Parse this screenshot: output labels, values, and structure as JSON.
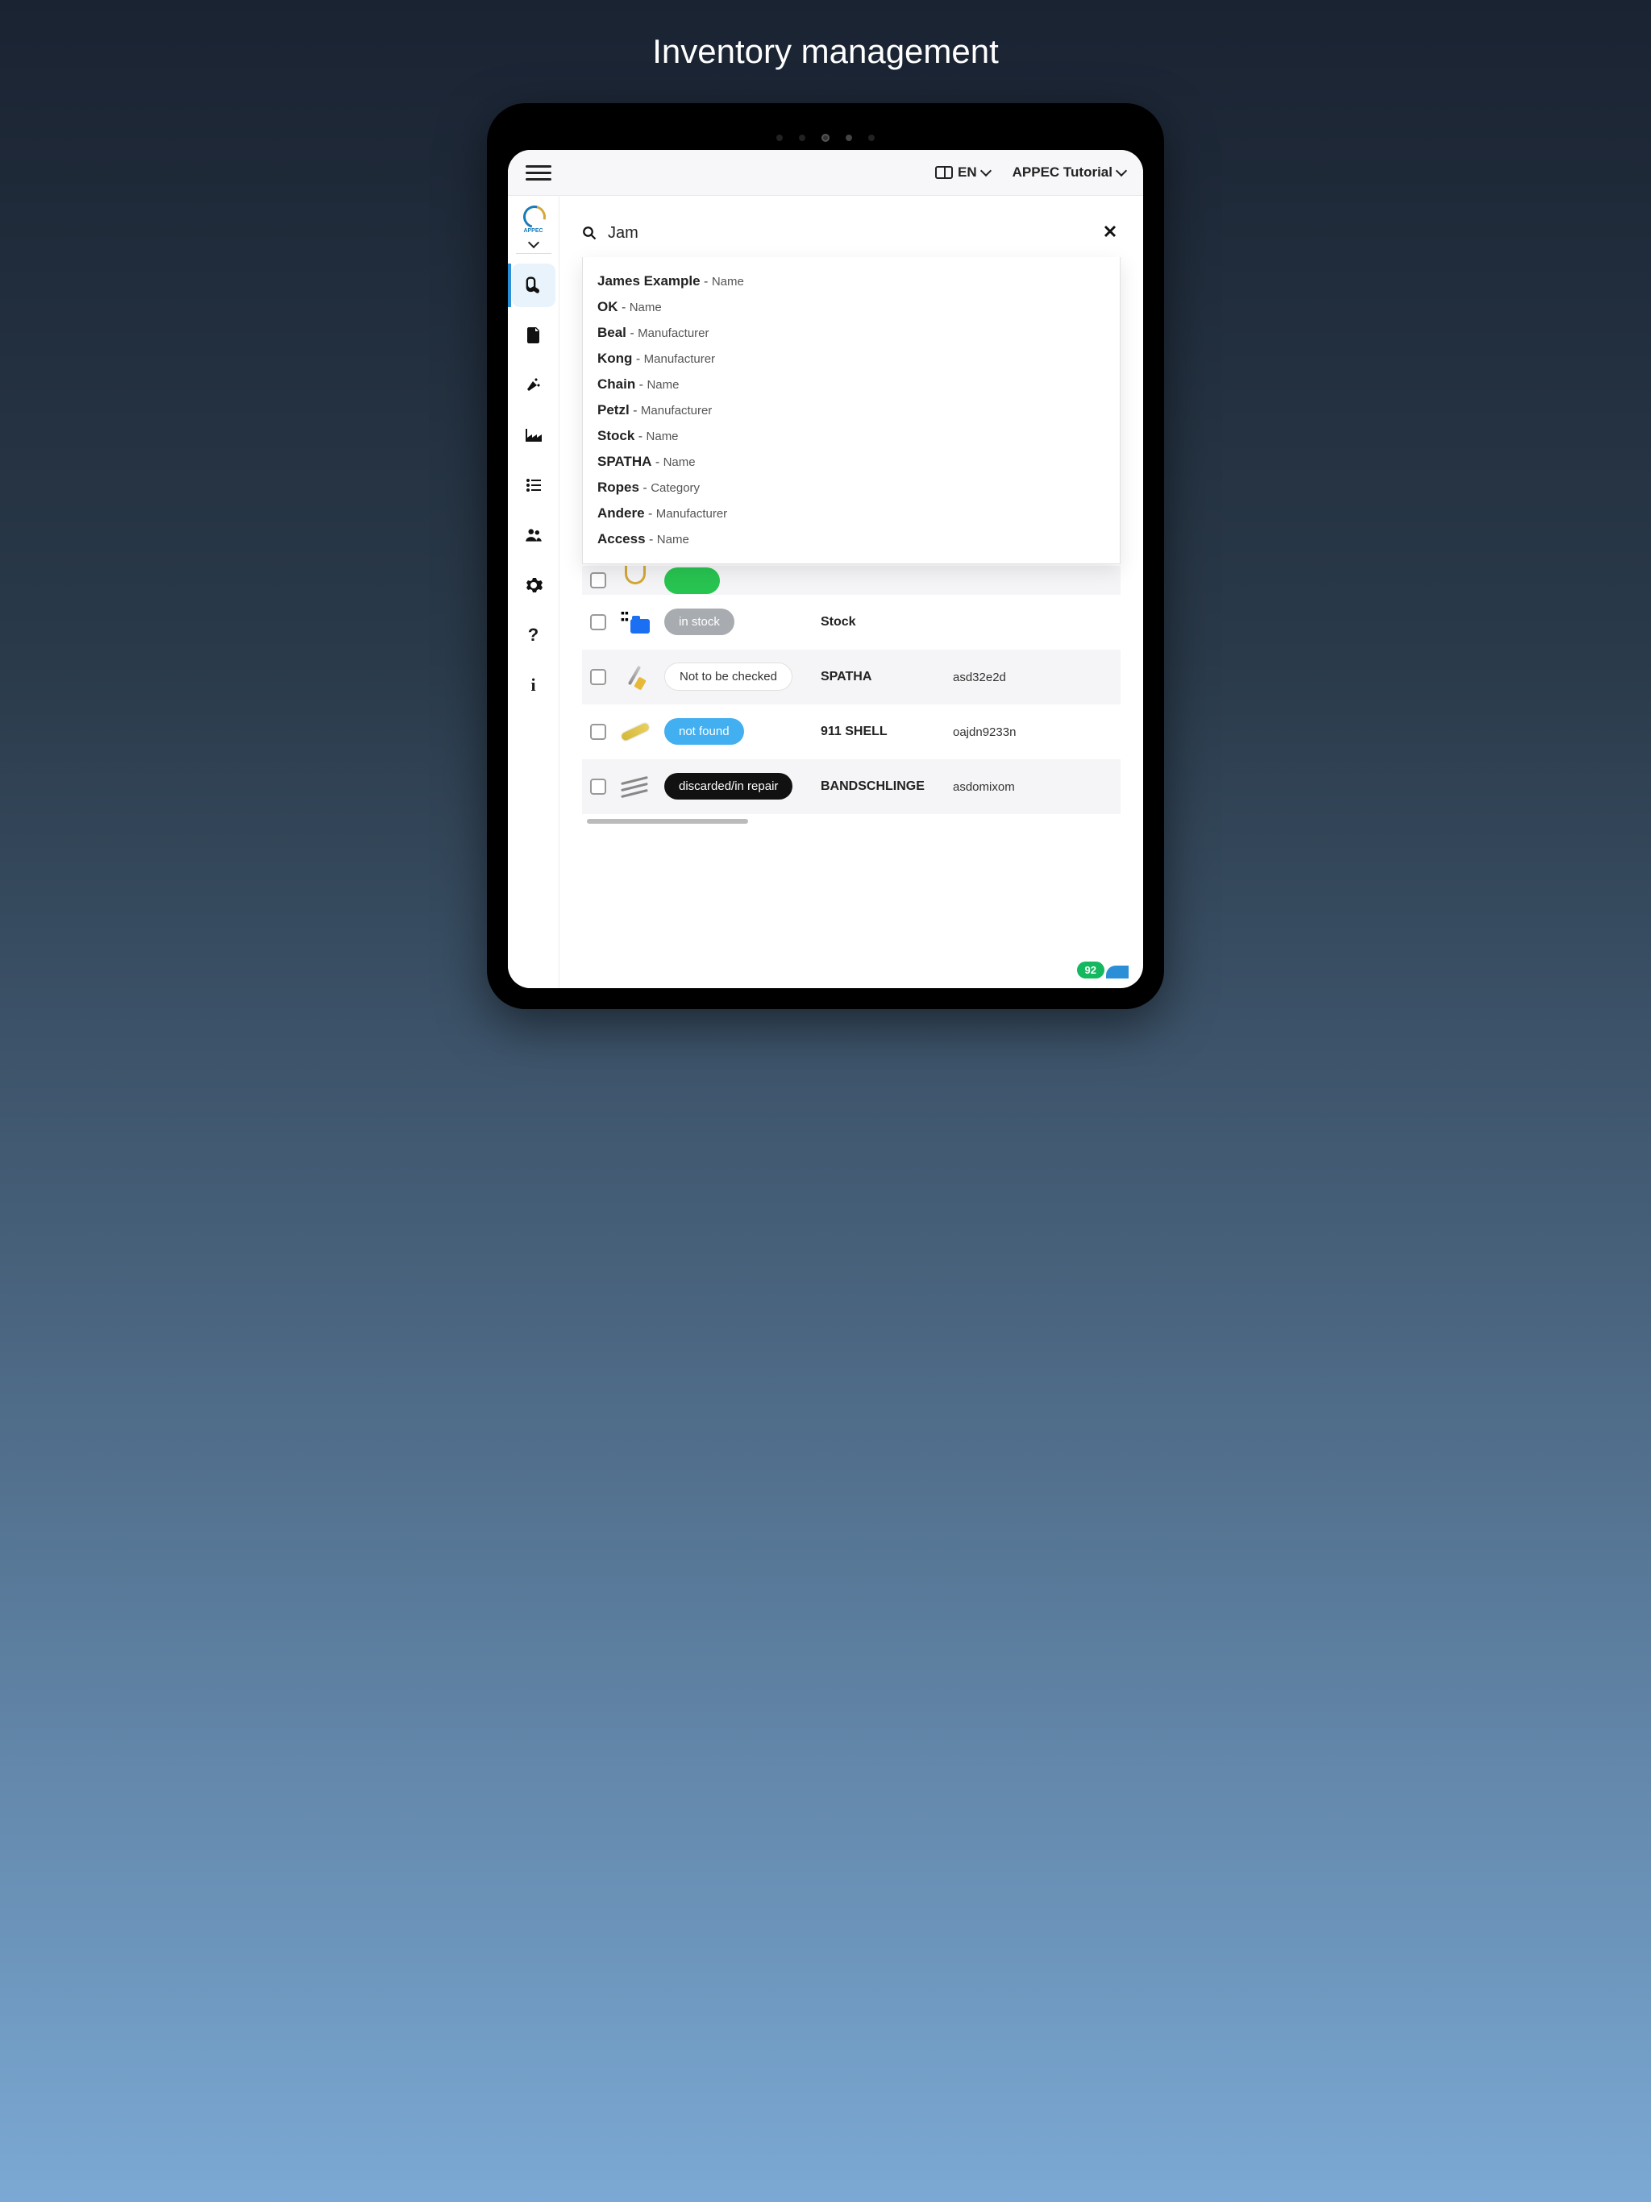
{
  "page_title": "Inventory management",
  "topbar": {
    "language_label": "EN",
    "tutorial_label": "APPEC Tutorial"
  },
  "sidebar": {
    "logo_text": "APPEC",
    "items": [
      {
        "name": "equipment",
        "active": true
      },
      {
        "name": "document",
        "active": false
      },
      {
        "name": "tools",
        "active": false
      },
      {
        "name": "industry",
        "active": false
      },
      {
        "name": "list",
        "active": false
      },
      {
        "name": "users",
        "active": false
      },
      {
        "name": "settings",
        "active": false
      },
      {
        "name": "help",
        "active": false
      },
      {
        "name": "info",
        "active": false
      }
    ]
  },
  "search": {
    "value": "Jam",
    "placeholder": "Search"
  },
  "suggestions": [
    {
      "primary": "James Example",
      "secondary": "Name"
    },
    {
      "primary": "OK",
      "secondary": "Name"
    },
    {
      "primary": "Beal",
      "secondary": "Manufacturer"
    },
    {
      "primary": "Kong",
      "secondary": "Manufacturer"
    },
    {
      "primary": "Chain",
      "secondary": "Name"
    },
    {
      "primary": "Petzl",
      "secondary": "Manufacturer"
    },
    {
      "primary": "Stock",
      "secondary": "Name"
    },
    {
      "primary": "SPATHA",
      "secondary": "Name"
    },
    {
      "primary": "Ropes",
      "secondary": "Category"
    },
    {
      "primary": "Andere",
      "secondary": "Manufacturer"
    },
    {
      "primary": "Access",
      "secondary": "Name"
    }
  ],
  "rows": [
    {
      "icon": "carabiner",
      "status": "",
      "status_class": "green",
      "name": "",
      "code": "",
      "alt": true,
      "partial": true
    },
    {
      "icon": "folder",
      "status": "in stock",
      "status_class": "gray",
      "name": "Stock",
      "code": "",
      "alt": false
    },
    {
      "icon": "knife",
      "status": "Not to be checked",
      "status_class": "white",
      "name": "SPATHA",
      "code": "asd32e2d",
      "alt": true
    },
    {
      "icon": "shell",
      "status": "not found",
      "status_class": "blue",
      "name": "911 SHELL",
      "code": "oajdn9233n",
      "alt": false
    },
    {
      "icon": "bands",
      "status": "discarded/in repair",
      "status_class": "black",
      "name": "BANDSCHLINGE",
      "code": "asdomixom",
      "alt": true
    }
  ],
  "badge_count": "92"
}
